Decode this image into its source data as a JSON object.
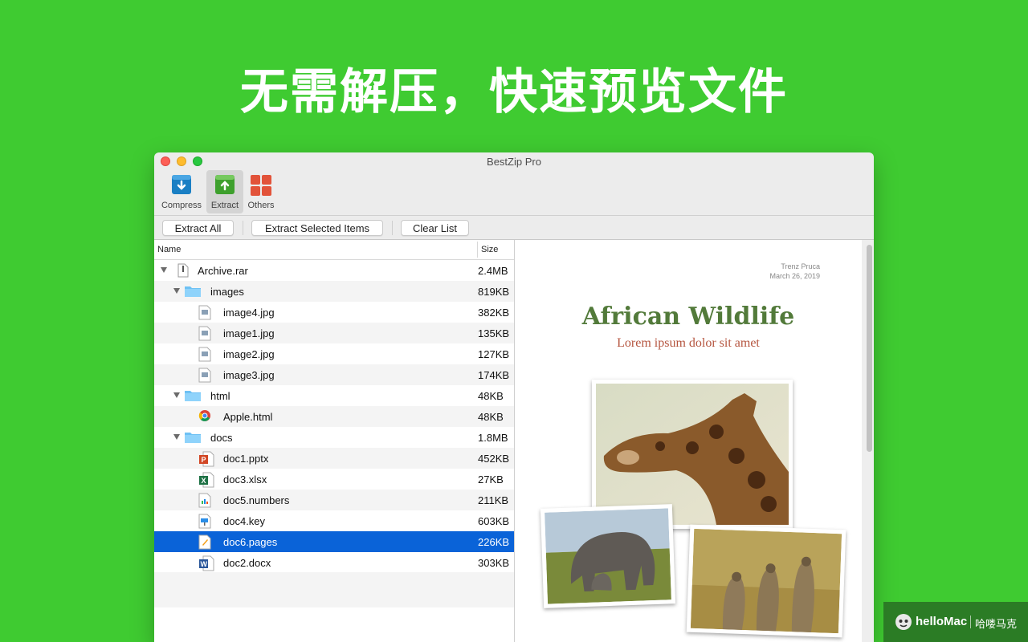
{
  "headline": "无需解压，快速预览文件",
  "window": {
    "title": "BestZip Pro"
  },
  "toolbar": {
    "compress": "Compress",
    "extract": "Extract",
    "others": "Others"
  },
  "actions": {
    "extract_all": "Extract All",
    "extract_selected": "Extract Selected Items",
    "clear_list": "Clear List"
  },
  "columns": {
    "name": "Name",
    "size": "Size"
  },
  "files": [
    {
      "name": "Archive.rar",
      "size": "2.4MB",
      "icon": "archive-icon",
      "level": 0,
      "expanded": true
    },
    {
      "name": "images",
      "size": "819KB",
      "icon": "folder-icon",
      "level": 1,
      "expanded": true
    },
    {
      "name": "image4.jpg",
      "size": "382KB",
      "icon": "jpg-file-icon",
      "level": 2
    },
    {
      "name": "image1.jpg",
      "size": "135KB",
      "icon": "jpg-file-icon",
      "level": 2
    },
    {
      "name": "image2.jpg",
      "size": "127KB",
      "icon": "jpg-file-icon",
      "level": 2
    },
    {
      "name": "image3.jpg",
      "size": "174KB",
      "icon": "jpg-file-icon",
      "level": 2
    },
    {
      "name": "html",
      "size": "48KB",
      "icon": "folder-icon",
      "level": 1,
      "expanded": true
    },
    {
      "name": "Apple.html",
      "size": "48KB",
      "icon": "chrome-html-icon",
      "level": 2
    },
    {
      "name": "docs",
      "size": "1.8MB",
      "icon": "folder-icon",
      "level": 1,
      "expanded": true
    },
    {
      "name": "doc1.pptx",
      "size": "452KB",
      "icon": "powerpoint-icon",
      "level": 2
    },
    {
      "name": "doc3.xlsx",
      "size": "27KB",
      "icon": "excel-icon",
      "level": 2
    },
    {
      "name": "doc5.numbers",
      "size": "211KB",
      "icon": "numbers-icon",
      "level": 2
    },
    {
      "name": "doc4.key",
      "size": "603KB",
      "icon": "keynote-icon",
      "level": 2
    },
    {
      "name": "doc6.pages",
      "size": "226KB",
      "icon": "pages-icon",
      "level": 2,
      "selected": true
    },
    {
      "name": "doc2.docx",
      "size": "303KB",
      "icon": "word-icon",
      "level": 2
    }
  ],
  "preview": {
    "author": "Trenz Pruca",
    "date": "March 26, 2019",
    "title": "African Wildlife",
    "subtitle": "Lorem ipsum dolor sit amet"
  },
  "watermark": {
    "brand": "helloMac",
    "cn": "哈喽马克"
  },
  "colors": {
    "background": "#3fcb31",
    "selection": "#0a63d8",
    "doc_title": "#527a3a",
    "doc_subtitle": "#b5553f"
  }
}
